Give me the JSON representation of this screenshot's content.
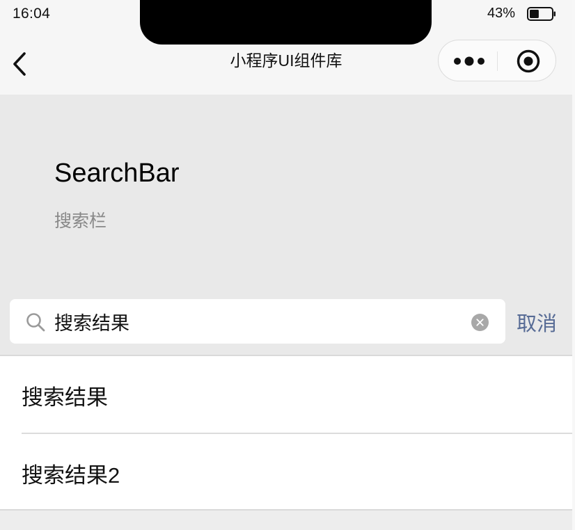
{
  "status_bar": {
    "time": "16:04",
    "battery_percent": "43%",
    "battery_level": 0.43
  },
  "nav": {
    "title": "小程序UI组件库",
    "back_icon": "chevron-left-icon",
    "more_icon": "more-dots-icon",
    "close_icon": "target-close-icon"
  },
  "header": {
    "title": "SearchBar",
    "description": "搜索栏"
  },
  "search": {
    "value": "搜索结果",
    "cancel_label": "取消",
    "search_icon": "search-icon",
    "clear_icon": "clear-icon"
  },
  "results": [
    {
      "label": "搜索结果"
    },
    {
      "label": "搜索结果2"
    }
  ],
  "colors": {
    "accent": "#576B95",
    "page_background": "#EDEDED",
    "nav_background": "#F6F6F6"
  }
}
